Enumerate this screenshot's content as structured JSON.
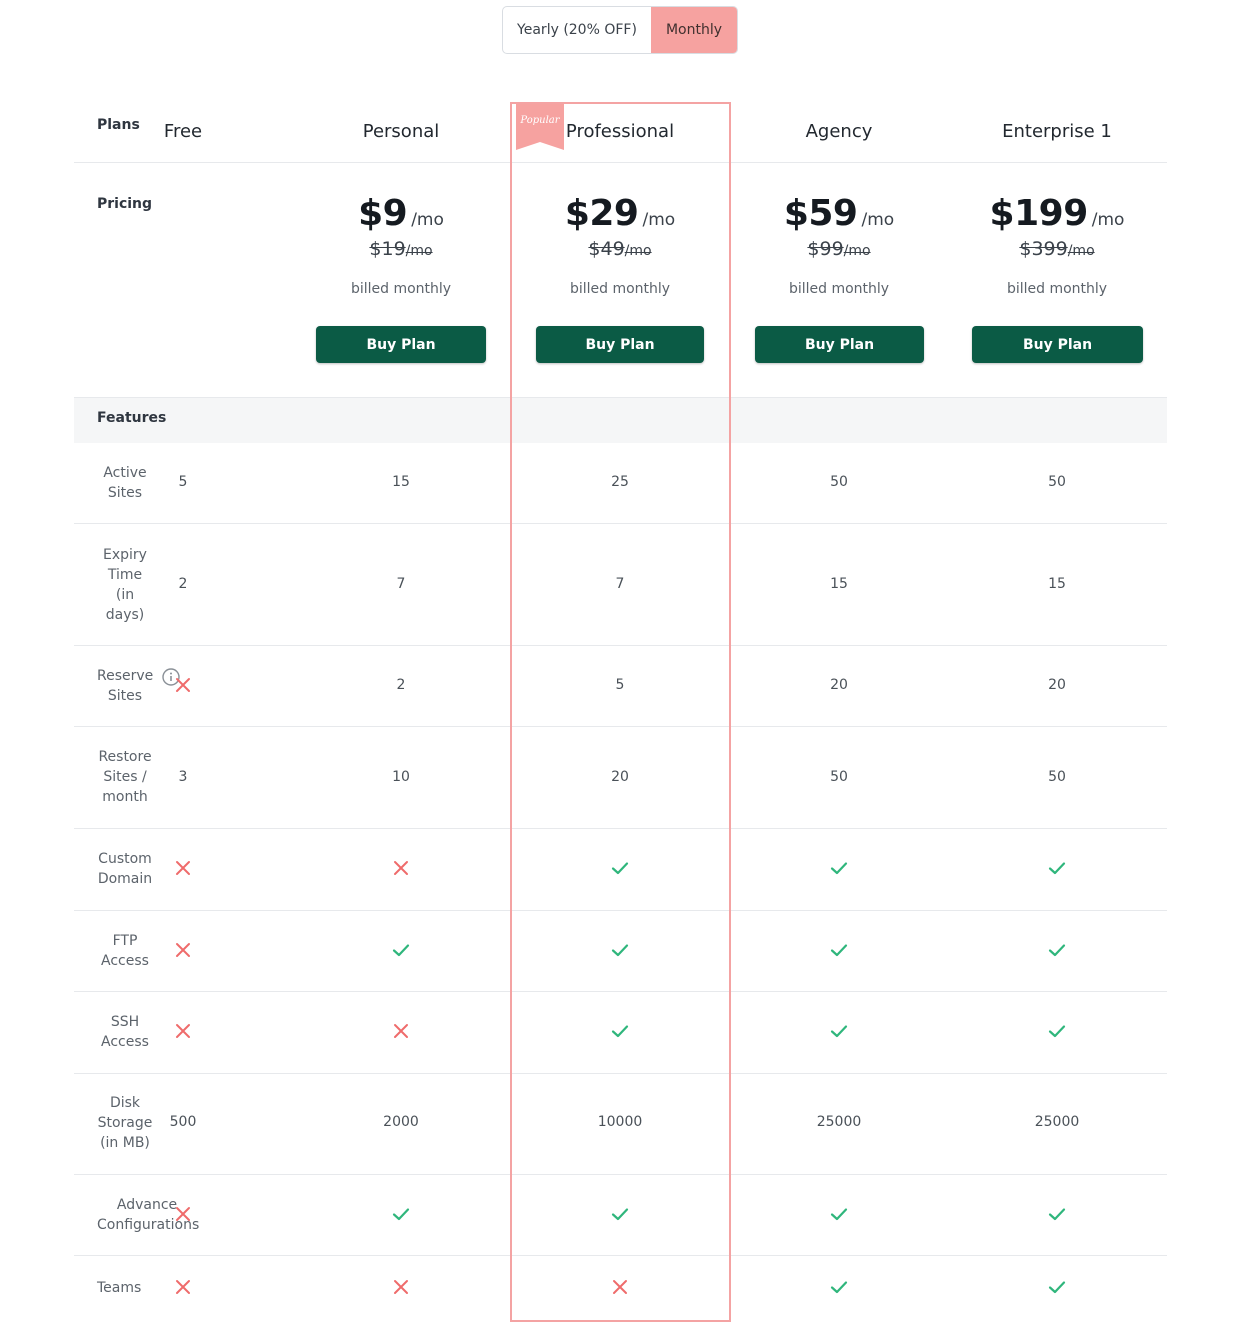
{
  "billing_toggle": {
    "yearly_label": "Yearly (20% OFF)",
    "monthly_label": "Monthly",
    "selected": "Monthly"
  },
  "colors": {
    "accent": "#f6a2a0",
    "button": "#0b5b45",
    "check": "#2fb67c",
    "cross": "#ef6b6b"
  },
  "table": {
    "plans_label": "Plans",
    "pricing_label": "Pricing",
    "features_label": "Features",
    "popular_badge": "Popular",
    "plans": [
      {
        "name": "Free"
      },
      {
        "name": "Personal",
        "price": "$9",
        "per": "/mo",
        "old_price": "$19",
        "old_per": "/mo",
        "billed": "billed monthly",
        "button": "Buy Plan"
      },
      {
        "name": "Professional",
        "price": "$29",
        "per": "/mo",
        "old_price": "$49",
        "old_per": "/mo",
        "billed": "billed monthly",
        "button": "Buy Plan",
        "popular": true
      },
      {
        "name": "Agency",
        "price": "$59",
        "per": "/mo",
        "old_price": "$99",
        "old_per": "/mo",
        "billed": "billed monthly",
        "button": "Buy Plan"
      },
      {
        "name": "Enterprise 1",
        "price": "$199",
        "per": "/mo",
        "old_price": "$399",
        "old_per": "/mo",
        "billed": "billed monthly",
        "button": "Buy Plan"
      }
    ],
    "features": [
      {
        "label": "Active Sites",
        "values": [
          "5",
          "15",
          "25",
          "50",
          "50"
        ]
      },
      {
        "label": "Expiry Time (in days)",
        "values": [
          "2",
          "7",
          "7",
          "15",
          "15"
        ]
      },
      {
        "label": "Reserve Sites",
        "values": [
          "no",
          "2",
          "5",
          "20",
          "20"
        ],
        "info_icon": true
      },
      {
        "label": "Restore Sites / month",
        "values": [
          "3",
          "10",
          "20",
          "50",
          "50"
        ]
      },
      {
        "label": "Custom Domain",
        "values": [
          "no",
          "no",
          "yes",
          "yes",
          "yes"
        ]
      },
      {
        "label": "FTP Access",
        "values": [
          "no",
          "yes",
          "yes",
          "yes",
          "yes"
        ]
      },
      {
        "label": "SSH Access",
        "values": [
          "no",
          "no",
          "yes",
          "yes",
          "yes"
        ]
      },
      {
        "label": "Disk Storage (in MB)",
        "values": [
          "500",
          "2000",
          "10000",
          "25000",
          "25000"
        ]
      },
      {
        "label": "Advance Configurations",
        "values": [
          "no",
          "yes",
          "yes",
          "yes",
          "yes"
        ]
      },
      {
        "label": "Teams",
        "values": [
          "no",
          "no",
          "no",
          "yes",
          "yes"
        ]
      }
    ]
  }
}
